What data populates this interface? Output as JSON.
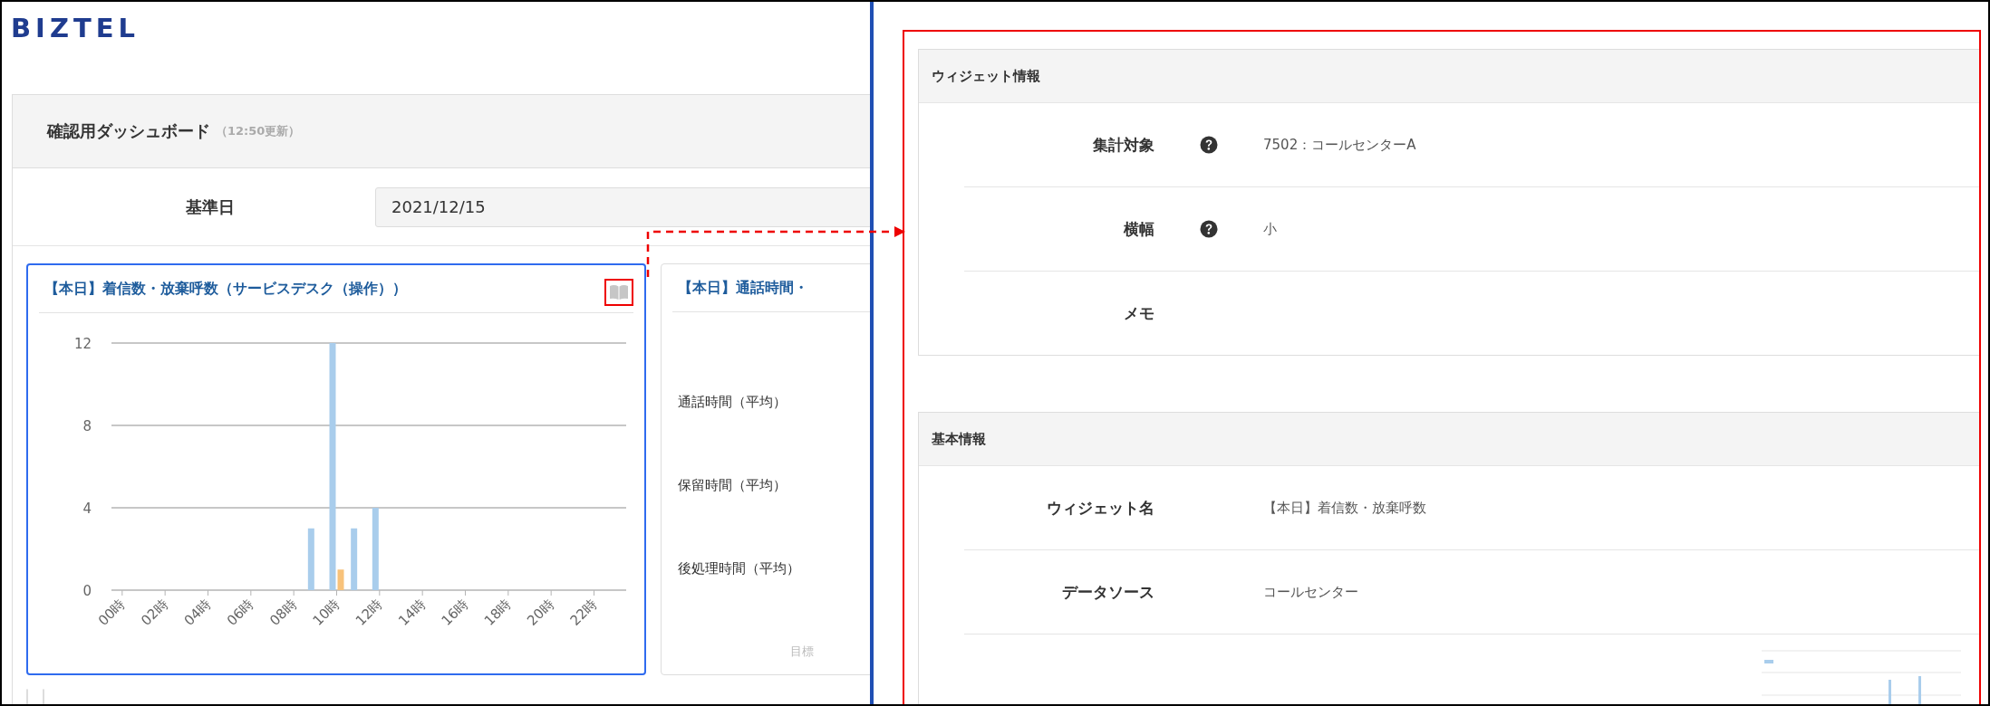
{
  "logo": "BIZTEL",
  "dashboard": {
    "title": "確認用ダッシュボード",
    "updated": "（12:50更新）",
    "date_label": "基準日",
    "date_value": "2021/12/15"
  },
  "widgets": [
    {
      "kind": "chart",
      "title": "【本日】着信数・放棄呼数（サービスデスク（操作））",
      "selected": true,
      "chart_data": {
        "type": "bar",
        "x": [
          0,
          1,
          2,
          3,
          4,
          5,
          6,
          7,
          8,
          9,
          10,
          11,
          12,
          13,
          14,
          15,
          16,
          17,
          18,
          19,
          20,
          21,
          22,
          23
        ],
        "series": [
          {
            "color": "#a9cdec",
            "values": [
              0,
              0,
              0,
              0,
              0,
              0,
              0,
              0,
              0,
              3,
              12,
              3,
              4,
              0,
              0,
              0,
              0,
              0,
              0,
              0,
              0,
              0,
              0,
              0
            ]
          },
          {
            "color": "#f8c27a",
            "values": [
              0,
              0,
              0,
              0,
              0,
              0,
              0,
              0,
              0,
              0,
              1,
              0,
              0,
              0,
              0,
              0,
              0,
              0,
              0,
              0,
              0,
              0,
              0,
              0
            ]
          }
        ],
        "xlim": [
          -0.5,
          23.5
        ],
        "ylim": [
          0,
          12
        ],
        "yticks": [
          0,
          4,
          8,
          12
        ],
        "xticks": [
          {
            "value": 0,
            "label": "00時"
          },
          {
            "value": 2,
            "label": "02時"
          },
          {
            "value": 4,
            "label": "04時"
          },
          {
            "value": 6,
            "label": "06時"
          },
          {
            "value": 8,
            "label": "08時"
          },
          {
            "value": 10,
            "label": "10時"
          },
          {
            "value": 12,
            "label": "12時"
          },
          {
            "value": 14,
            "label": "14時"
          },
          {
            "value": 16,
            "label": "16時"
          },
          {
            "value": 18,
            "label": "18時"
          },
          {
            "value": 20,
            "label": "20時"
          },
          {
            "value": 22,
            "label": "22時"
          }
        ]
      }
    },
    {
      "kind": "metrics",
      "title": "【本日】通話時間・",
      "selected": false,
      "rows": [
        "通話時間（平均）",
        "保留時間（平均）",
        "後処理時間（平均）"
      ],
      "footer": "目標"
    }
  ],
  "widget_info": {
    "title": "ウィジェット情報",
    "rows": [
      {
        "kind": "text",
        "label": "集計対象",
        "help": true,
        "value": "7502：コールセンターA"
      },
      {
        "kind": "text",
        "label": "横幅",
        "help": true,
        "value": "小"
      },
      {
        "kind": "text",
        "label": "メモ",
        "help": false
      }
    ]
  },
  "basic_info": {
    "title": "基本情報",
    "rows": [
      {
        "kind": "text",
        "label": "ウィジェット名",
        "help": false,
        "value": "【本日】着信数・放棄呼数"
      },
      {
        "kind": "text",
        "label": "データソース",
        "help": false,
        "value": "コールセンター"
      },
      {
        "kind": "preview"
      }
    ]
  }
}
